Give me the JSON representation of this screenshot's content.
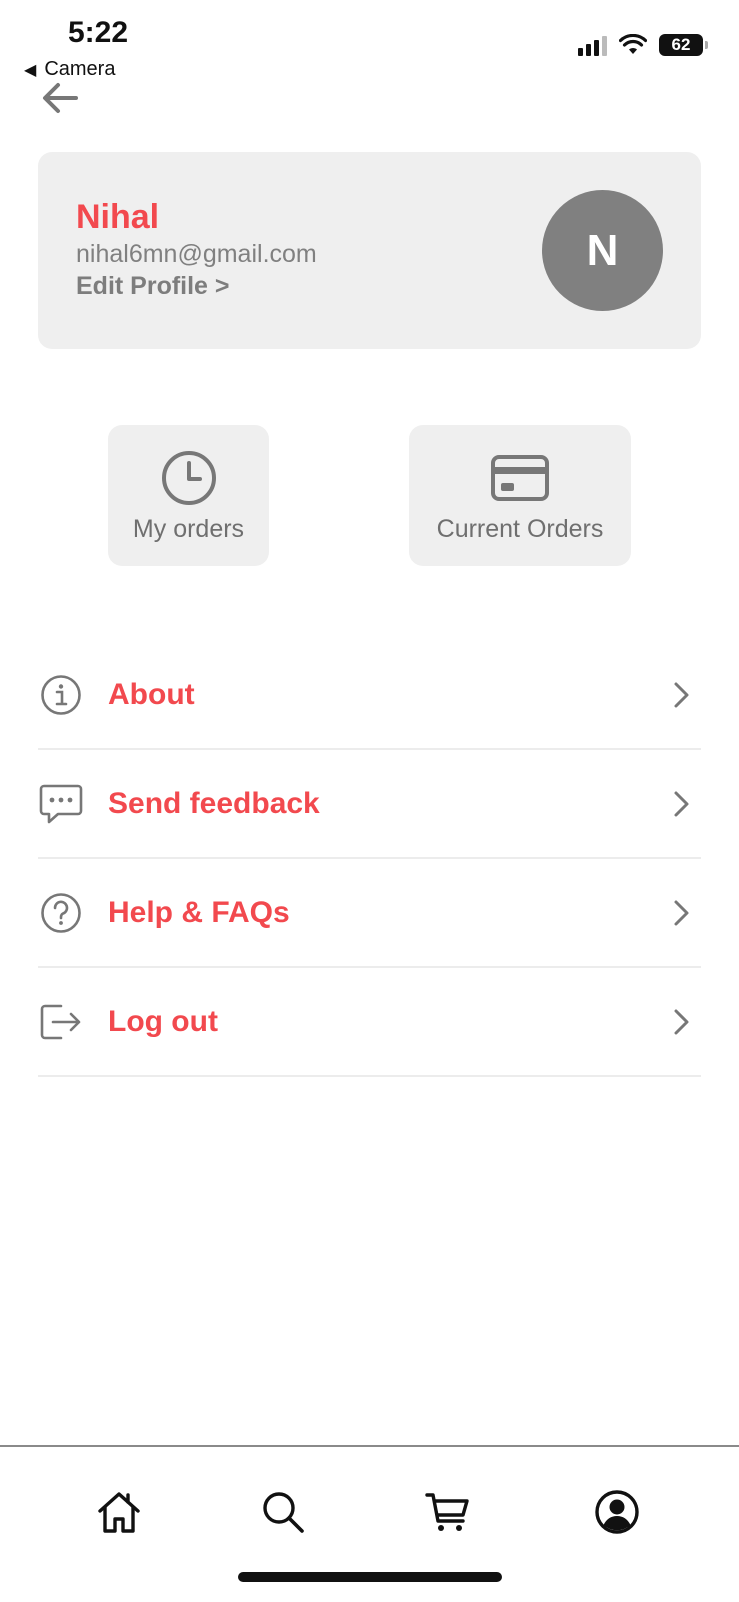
{
  "status_bar": {
    "time": "5:22",
    "back_app": "Camera",
    "battery": "62"
  },
  "profile": {
    "name": "Nihal",
    "email": "nihal6mn@gmail.com",
    "edit_label": "Edit Profile >",
    "avatar_initial": "N"
  },
  "tiles": [
    {
      "label": "My orders",
      "icon": "clock-icon"
    },
    {
      "label": "Current Orders",
      "icon": "credit-card-icon"
    }
  ],
  "menu": {
    "items": [
      {
        "label": "About",
        "icon": "info-icon"
      },
      {
        "label": "Send feedback",
        "icon": "chat-bubble-icon"
      },
      {
        "label": "Help & FAQs",
        "icon": "question-icon"
      },
      {
        "label": "Log out",
        "icon": "logout-icon"
      }
    ]
  },
  "bottom_nav": {
    "items": [
      "home-icon",
      "search-icon",
      "cart-icon",
      "account-icon"
    ],
    "active": "account-icon"
  },
  "colors": {
    "accent": "#f2494e",
    "card_bg": "#efefef",
    "muted_text": "#808080",
    "avatar_bg": "#808080"
  }
}
